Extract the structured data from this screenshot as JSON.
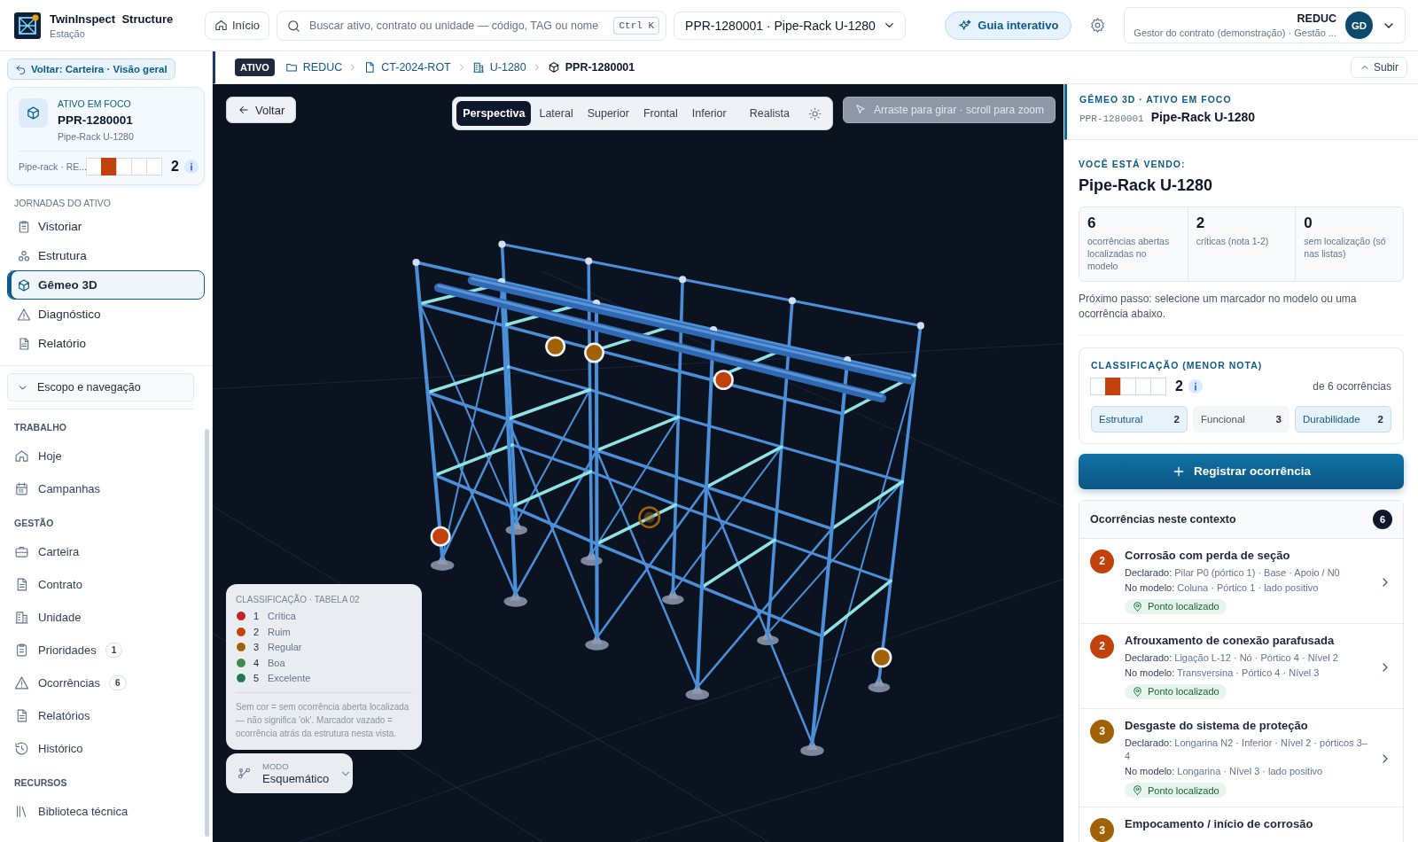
{
  "app": {
    "name": "TwinInspect",
    "suffix": "Structure",
    "subtitle": "Estação"
  },
  "topbar": {
    "home": "Início",
    "search": {
      "placeholder": "Buscar ativo, contrato ou unidade — código, TAG ou nome",
      "shortcut": "Ctrl K"
    },
    "asset_select": "PPR-1280001 · Pipe-Rack U-1280",
    "guide": "Guia interativo",
    "user": {
      "org": "REDUC",
      "role": "Gestor do contrato (demonstração) · Gestão ...",
      "initials": "GD"
    }
  },
  "breadcrumb": {
    "badge": "ATIVO",
    "items": [
      {
        "label": "REDUC",
        "current": false
      },
      {
        "label": "CT-2024-ROT",
        "current": false
      },
      {
        "label": "U-1280",
        "current": false
      },
      {
        "label": "PPR-1280001",
        "current": true
      }
    ],
    "up": "Subir"
  },
  "sidebar": {
    "back": "Voltar: Carteira · Visão geral",
    "focus": {
      "caption": "ATIVO EM FOCO",
      "code": "PPR-1280001",
      "name": "Pipe-Rack U-1280",
      "type": "Pipe-rack · RE...",
      "rating": {
        "value": "2",
        "color": "#c2410c",
        "cells": [
          false,
          true,
          false,
          false,
          false
        ]
      }
    },
    "journeys": {
      "title": "JORNADAS DO ATIVO",
      "items": [
        {
          "label": "Vistoriar",
          "selected": false
        },
        {
          "label": "Estrutura",
          "selected": false
        },
        {
          "label": "Gêmeo 3D",
          "selected": true
        },
        {
          "label": "Diagnóstico",
          "selected": false
        },
        {
          "label": "Relatório",
          "selected": false
        }
      ]
    },
    "scope": "Escopo e navegação",
    "sections": [
      {
        "title": "TRABALHO",
        "items": [
          {
            "label": "Hoje"
          },
          {
            "label": "Campanhas"
          }
        ]
      },
      {
        "title": "GESTÃO",
        "items": [
          {
            "label": "Carteira"
          },
          {
            "label": "Contrato"
          },
          {
            "label": "Unidade"
          },
          {
            "label": "Prioridades",
            "count": "1"
          },
          {
            "label": "Ocorrências",
            "count": "6"
          },
          {
            "label": "Relatórios"
          },
          {
            "label": "Histórico"
          }
        ]
      },
      {
        "title": "RECURSOS",
        "items": [
          {
            "label": "Biblioteca técnica"
          }
        ]
      }
    ]
  },
  "viewer": {
    "back": "Voltar",
    "views": [
      {
        "label": "Perspectiva",
        "selected": true
      },
      {
        "label": "Lateral",
        "selected": false
      },
      {
        "label": "Superior",
        "selected": false
      },
      {
        "label": "Frontal",
        "selected": false
      },
      {
        "label": "Inferior",
        "selected": false
      },
      {
        "label": "Realista",
        "selected": false
      }
    ],
    "hint": "Arraste para girar · scroll para zoom",
    "legend": {
      "title": "CLASSIFICAÇÃO · TABELA 02",
      "items": [
        {
          "grade": "1",
          "label": "Crítica",
          "color": "#c8202c"
        },
        {
          "grade": "2",
          "label": "Ruim",
          "color": "#c2410c"
        },
        {
          "grade": "3",
          "label": "Regular",
          "color": "#a16207"
        },
        {
          "grade": "4",
          "label": "Boa",
          "color": "#3f8a50"
        },
        {
          "grade": "5",
          "label": "Excelente",
          "color": "#1f7a52"
        }
      ],
      "note": "Sem cor = sem ocorrência aberta localizada — não significa 'ok'. Marcador vazado = ocorrência atrás da estrutura nesta vista."
    },
    "mode": {
      "caption": "MODO",
      "value": "Esquemático"
    }
  },
  "panel": {
    "caption": "GÊMEO 3D · ATIVO EM FOCO",
    "code": "PPR-1280001",
    "name": "Pipe-Rack U-1280",
    "seeing_caption": "VOCÊ ESTÁ VENDO:",
    "seeing": "Pipe-Rack U-1280",
    "stats": [
      {
        "value": "6",
        "label": "ocorrências abertas localizadas no modelo"
      },
      {
        "value": "2",
        "label": "críticas (nota 1-2)"
      },
      {
        "value": "0",
        "label": "sem localização (só nas listas)"
      }
    ],
    "next_step": "Próximo passo: selecione um marcador no modelo ou uma ocorrência abaixo.",
    "classification": {
      "title": "CLASSIFICAÇÃO (MENOR NOTA)",
      "rating": {
        "value": "2",
        "color": "#c2410c",
        "cells": [
          false,
          true,
          false,
          false,
          false
        ]
      },
      "of": "de 6 ocorrências",
      "categories": [
        {
          "label": "Estrutural",
          "value": "2",
          "highlighted": true
        },
        {
          "label": "Funcional",
          "value": "3",
          "highlighted": false
        },
        {
          "label": "Durabilidade",
          "value": "2",
          "highlighted": true
        }
      ]
    },
    "register": "Registrar ocorrência",
    "occurrences": {
      "title": "Ocorrências neste contexto",
      "count": "6",
      "items": [
        {
          "grade": "2",
          "color": "#c2410c",
          "title": "Corrosão com perda de seção",
          "declared_label": "Declarado:",
          "declared": "Pilar P0 (pórtico 1) · Base · Apoio / N0",
          "model_label": "No modelo:",
          "model": "Coluna · Pórtico 1 · lado positivo",
          "status": "Ponto localizado"
        },
        {
          "grade": "2",
          "color": "#c2410c",
          "title": "Afrouxamento de conexão parafusada",
          "declared_label": "Declarado:",
          "declared": "Ligação L-12 · Nó · Pórtico 4 · Nível 2",
          "model_label": "No modelo:",
          "model": "Transversina · Pórtico 4 · Nível 3",
          "status": "Ponto localizado"
        },
        {
          "grade": "3",
          "color": "#a16207",
          "title": "Desgaste do sistema de proteção",
          "declared_label": "Declarado:",
          "declared": "Longarina N2 · Inferior · Nível 2 · pórticos 3–4",
          "model_label": "No modelo:",
          "model": "Longarina · Nível 3 · lado positivo",
          "status": "Ponto localizado"
        },
        {
          "grade": "3",
          "color": "#a16207",
          "title": "Empocamento / início de corrosão"
        }
      ]
    }
  }
}
